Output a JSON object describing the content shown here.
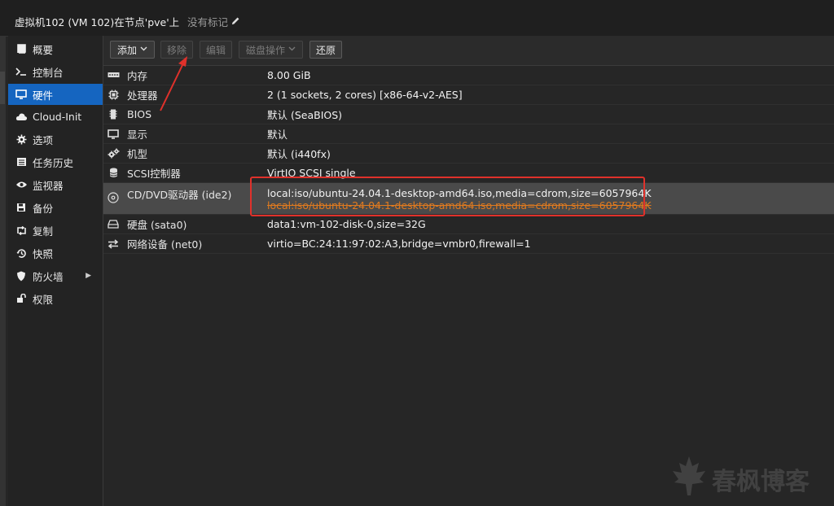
{
  "header": {
    "title": "虚拟机102 (VM 102)在节点'pve'上",
    "tags_label": "没有标记"
  },
  "sidebar": {
    "items": [
      {
        "label": "概要",
        "icon": "book-icon"
      },
      {
        "label": "控制台",
        "icon": "terminal-icon"
      },
      {
        "label": "硬件",
        "icon": "monitor-icon",
        "active": true
      },
      {
        "label": "Cloud-Init",
        "icon": "cloud-icon"
      },
      {
        "label": "选项",
        "icon": "gear-icon"
      },
      {
        "label": "任务历史",
        "icon": "list-icon"
      },
      {
        "label": "监视器",
        "icon": "eye-icon"
      },
      {
        "label": "备份",
        "icon": "floppy-icon"
      },
      {
        "label": "复制",
        "icon": "retweet-icon"
      },
      {
        "label": "快照",
        "icon": "history-icon"
      },
      {
        "label": "防火墙",
        "icon": "shield-icon",
        "has_arrow": true
      },
      {
        "label": "权限",
        "icon": "unlock-icon"
      }
    ]
  },
  "toolbar": {
    "add_label": "添加",
    "remove_label": "移除",
    "edit_label": "编辑",
    "disk_action_label": "磁盘操作",
    "revert_label": "还原"
  },
  "hardware": {
    "rows": [
      {
        "name": "内存",
        "value": "8.00 GiB",
        "icon": "memory-icon",
        "muted": true
      },
      {
        "name": "处理器",
        "value": "2 (1 sockets, 2 cores) [x86-64-v2-AES]",
        "icon": "cpu-icon",
        "muted": true
      },
      {
        "name": "BIOS",
        "value": "默认 (SeaBIOS)",
        "icon": "microchip-icon"
      },
      {
        "name": "显示",
        "value": "默认",
        "icon": "display-icon"
      },
      {
        "name": "机型",
        "value": "默认 (i440fx)",
        "icon": "cogs-icon"
      },
      {
        "name": "SCSI控制器",
        "value": "VirtIO SCSI single",
        "icon": "database-icon"
      },
      {
        "name": "CD/DVD驱动器 (ide2)",
        "value": "local:iso/ubuntu-24.04.1-desktop-amd64.iso,media=cdrom,size=6057964K",
        "pending_value": "local:iso/ubuntu-24.04.1-desktop-amd64.iso,media=cdrom,size=6057964K",
        "icon": "cdrom-icon",
        "selected": true
      },
      {
        "name": "硬盘 (sata0)",
        "value": "data1:vm-102-disk-0,size=32G",
        "icon": "hdd-icon"
      },
      {
        "name": "网络设备 (net0)",
        "value": "virtio=BC:24:11:97:02:A3,bridge=vmbr0,firewall=1",
        "icon": "exchange-icon"
      }
    ]
  },
  "annotations": {
    "highlight_color": "#e0312b",
    "pending_color": "#e07a1f",
    "active_nav_color": "#1565c0"
  },
  "watermark": {
    "text": "春枫博客",
    "icon": "maple-leaf-icon"
  }
}
